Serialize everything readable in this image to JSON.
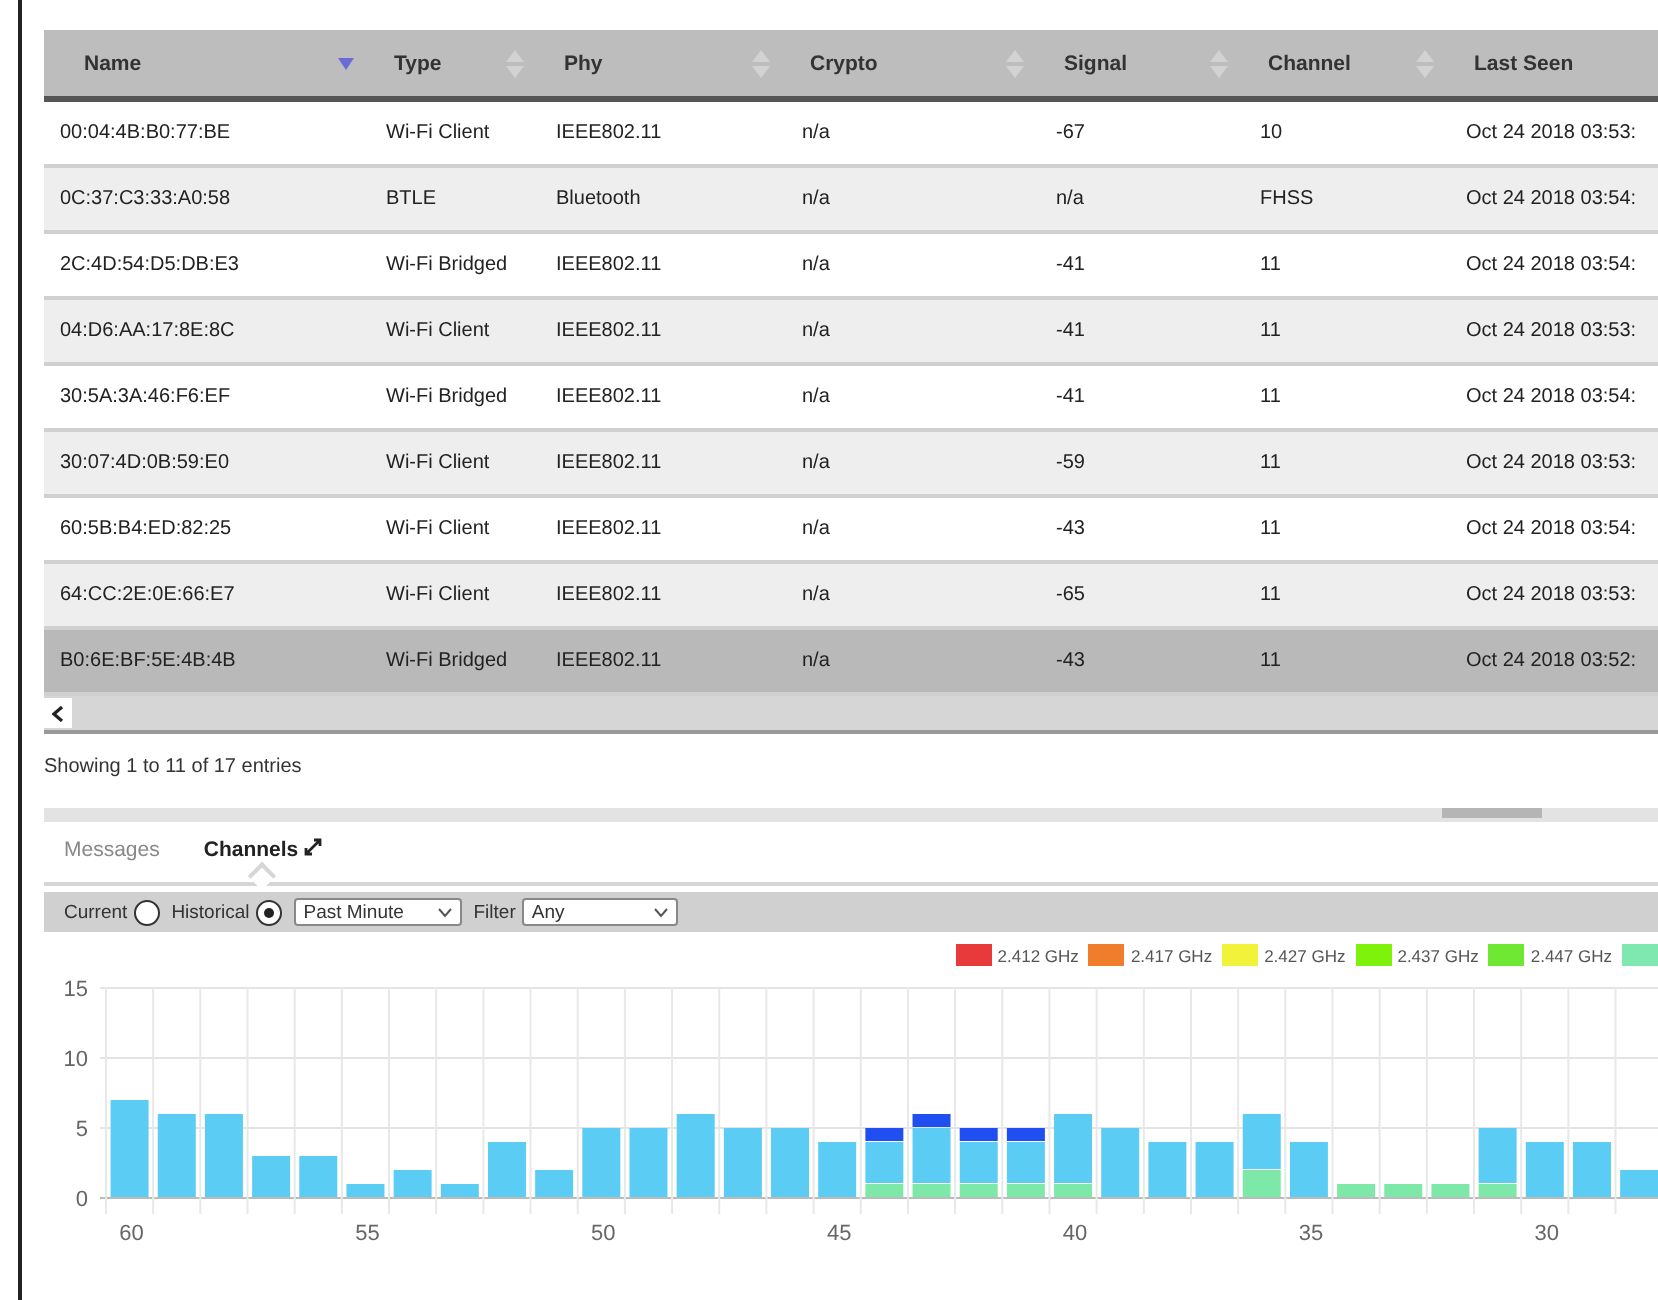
{
  "table": {
    "columns": [
      {
        "label": "Name",
        "sorted": true
      },
      {
        "label": "Type",
        "sorted": false
      },
      {
        "label": "Phy",
        "sorted": false
      },
      {
        "label": "Crypto",
        "sorted": false
      },
      {
        "label": "Signal",
        "sorted": false
      },
      {
        "label": "Channel",
        "sorted": false
      },
      {
        "label": "Last Seen"
      }
    ],
    "rows": [
      {
        "cells": [
          "00:04:4B:B0:77:BE",
          "Wi-Fi Client",
          "IEEE802.11",
          "n/a",
          "-67",
          "10",
          "Oct 24 2018 03:53:"
        ],
        "selected": false
      },
      {
        "cells": [
          "0C:37:C3:33:A0:58",
          "BTLE",
          "Bluetooth",
          "n/a",
          "n/a",
          "FHSS",
          "Oct 24 2018 03:54:"
        ],
        "selected": false
      },
      {
        "cells": [
          "2C:4D:54:D5:DB:E3",
          "Wi-Fi Bridged",
          "IEEE802.11",
          "n/a",
          "-41",
          "11",
          "Oct 24 2018 03:54:"
        ],
        "selected": false
      },
      {
        "cells": [
          "04:D6:AA:17:8E:8C",
          "Wi-Fi Client",
          "IEEE802.11",
          "n/a",
          "-41",
          "11",
          "Oct 24 2018 03:53:"
        ],
        "selected": false
      },
      {
        "cells": [
          "30:5A:3A:46:F6:EF",
          "Wi-Fi Bridged",
          "IEEE802.11",
          "n/a",
          "-41",
          "11",
          "Oct 24 2018 03:54:"
        ],
        "selected": false
      },
      {
        "cells": [
          "30:07:4D:0B:59:E0",
          "Wi-Fi Client",
          "IEEE802.11",
          "n/a",
          "-59",
          "11",
          "Oct 24 2018 03:53:"
        ],
        "selected": false
      },
      {
        "cells": [
          "60:5B:B4:ED:82:25",
          "Wi-Fi Client",
          "IEEE802.11",
          "n/a",
          "-43",
          "11",
          "Oct 24 2018 03:54:"
        ],
        "selected": false
      },
      {
        "cells": [
          "64:CC:2E:0E:66:E7",
          "Wi-Fi Client",
          "IEEE802.11",
          "n/a",
          "-65",
          "11",
          "Oct 24 2018 03:53:"
        ],
        "selected": false
      },
      {
        "cells": [
          "B0:6E:BF:5E:4B:4B",
          "Wi-Fi Bridged",
          "IEEE802.11",
          "n/a",
          "-43",
          "11",
          "Oct 24 2018 03:52:"
        ],
        "selected": true
      }
    ],
    "info": "Showing 1 to 11 of 17 entries"
  },
  "panel": {
    "tabs": [
      {
        "label": "Messages",
        "selected": false,
        "expandable": false
      },
      {
        "label": "Channels",
        "selected": true,
        "expandable": true
      }
    ],
    "toolbar": {
      "modes": [
        {
          "label": "Current",
          "selected": false
        },
        {
          "label": "Historical",
          "selected": true
        }
      ],
      "range": {
        "value": "Past Minute"
      },
      "filter": {
        "label": "Filter",
        "value": "Any"
      }
    },
    "legend": [
      {
        "label": "2.412 GHz",
        "color": "#e83a3a"
      },
      {
        "label": "2.417 GHz",
        "color": "#ef7d2c"
      },
      {
        "label": "2.427 GHz",
        "color": "#f2f23a"
      },
      {
        "label": "2.437 GHz",
        "color": "#7ef20a"
      },
      {
        "label": "2.447 GHz",
        "color": "#6ee832"
      },
      {
        "color": "#7ee8b0"
      }
    ],
    "chart_data": {
      "type": "bar",
      "stacked": true,
      "x": [
        60,
        59,
        58,
        57,
        56,
        55,
        54,
        53,
        52,
        51,
        50,
        49,
        48,
        47,
        46,
        45,
        44,
        43,
        42,
        41,
        40,
        39,
        38,
        37,
        36,
        35,
        34,
        33,
        32,
        31,
        30,
        29,
        28
      ],
      "series": [
        {
          "color": "#7ee8a8",
          "values": [
            0,
            0,
            0,
            0,
            0,
            0,
            0,
            0,
            0,
            0,
            0,
            0,
            0,
            0,
            0,
            0,
            1,
            1,
            1,
            1,
            1,
            0,
            0,
            0,
            2,
            0,
            1,
            1,
            1,
            1,
            0,
            0,
            0
          ]
        },
        {
          "color": "#5bcdf5",
          "values": [
            7,
            6,
            6,
            3,
            3,
            1,
            2,
            1,
            4,
            2,
            5,
            5,
            6,
            5,
            5,
            4,
            3,
            4,
            3,
            3,
            5,
            5,
            4,
            4,
            4,
            4,
            0,
            0,
            0,
            4,
            4,
            4,
            2
          ]
        },
        {
          "color": "#1f4ff0",
          "values": [
            0,
            0,
            0,
            0,
            0,
            0,
            0,
            0,
            0,
            0,
            0,
            0,
            0,
            0,
            0,
            0,
            1,
            1,
            1,
            1,
            0,
            0,
            0,
            0,
            0,
            0,
            0,
            0,
            0,
            0,
            0,
            0,
            0
          ]
        }
      ],
      "xlim": [
        60.5,
        27.6
      ],
      "ylim": [
        0,
        15
      ],
      "yticks": [
        0,
        5,
        10,
        15
      ],
      "xticks": [
        60,
        55,
        50,
        45,
        40,
        35,
        30
      ]
    }
  }
}
